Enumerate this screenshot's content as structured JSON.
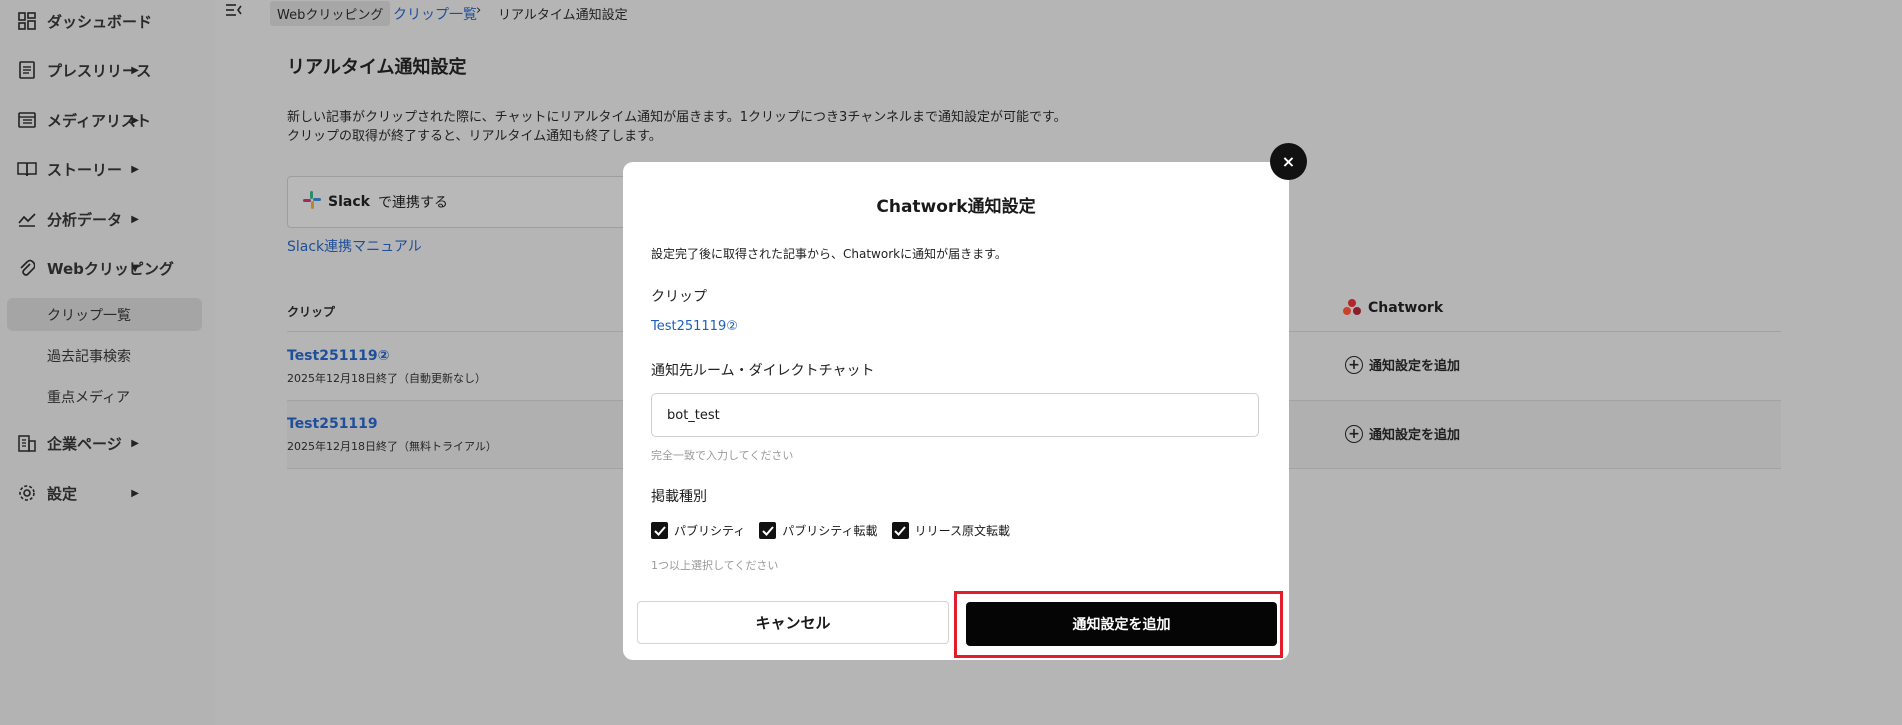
{
  "sidebar": {
    "items": [
      {
        "label": "ダッシュボード",
        "icon": "dashboard-icon"
      },
      {
        "label": "プレスリリース",
        "icon": "document-icon"
      },
      {
        "label": "メディアリスト",
        "icon": "list-icon"
      },
      {
        "label": "ストーリー",
        "icon": "book-icon"
      },
      {
        "label": "分析データ",
        "icon": "chart-icon"
      },
      {
        "label": "Webクリッピング",
        "icon": "paperclip-icon"
      },
      {
        "label": "企業ページ",
        "icon": "building-icon"
      },
      {
        "label": "設定",
        "icon": "gear-icon"
      }
    ],
    "sub_items": [
      {
        "label": "クリップ一覧",
        "active": true
      },
      {
        "label": "過去記事検索",
        "active": false
      },
      {
        "label": "重点メディア",
        "active": false
      }
    ]
  },
  "breadcrumb": {
    "section": "Webクリッピング",
    "link": "クリップ一覧",
    "current": "リアルタイム通知設定"
  },
  "page": {
    "title": "リアルタイム通知設定",
    "desc_line1": "新しい記事がクリップされた際に、チャットにリアルタイム通知が届きます。1クリップにつき3チャンネルまで通知設定が可能です。",
    "desc_line2": "クリップの取得が終了すると、リアルタイム通知も終了します。",
    "slack_word": "Slack",
    "slack_connect": "で連携する",
    "slack_manual": "Slack連携マニュアル"
  },
  "table": {
    "col_clip": "クリップ",
    "col_chatwork": "Chatwork",
    "rows": [
      {
        "title": "Test251119②",
        "sub": "2025年12月18日終了（自動更新なし）",
        "action": "通知設定を追加"
      },
      {
        "title": "Test251119",
        "sub": "2025年12月18日終了（無料トライアル）",
        "action": "通知設定を追加"
      }
    ]
  },
  "modal": {
    "close": "×",
    "title": "Chatwork通知設定",
    "note": "設定完了後に取得された記事から、Chatworkに通知が届きます。",
    "clip_label": "クリップ",
    "clip_value": "Test251119②",
    "room_label": "通知先ルーム・ダイレクトチャット",
    "room_value": "bot_test",
    "room_hint": "完全一致で入力してください",
    "type_label": "掲載種別",
    "checks": [
      {
        "label": "パブリシティ",
        "checked": true
      },
      {
        "label": "パブリシティ転載",
        "checked": true
      },
      {
        "label": "リリース原文転載",
        "checked": true
      }
    ],
    "type_hint": "1つ以上選択してください",
    "cancel": "キャンセル",
    "submit": "通知設定を追加"
  },
  "colors": {
    "overlay": "#b5b5b5",
    "link": "#1f4f9a",
    "highlight": "#e31b2b",
    "primary_button": "#050505"
  }
}
